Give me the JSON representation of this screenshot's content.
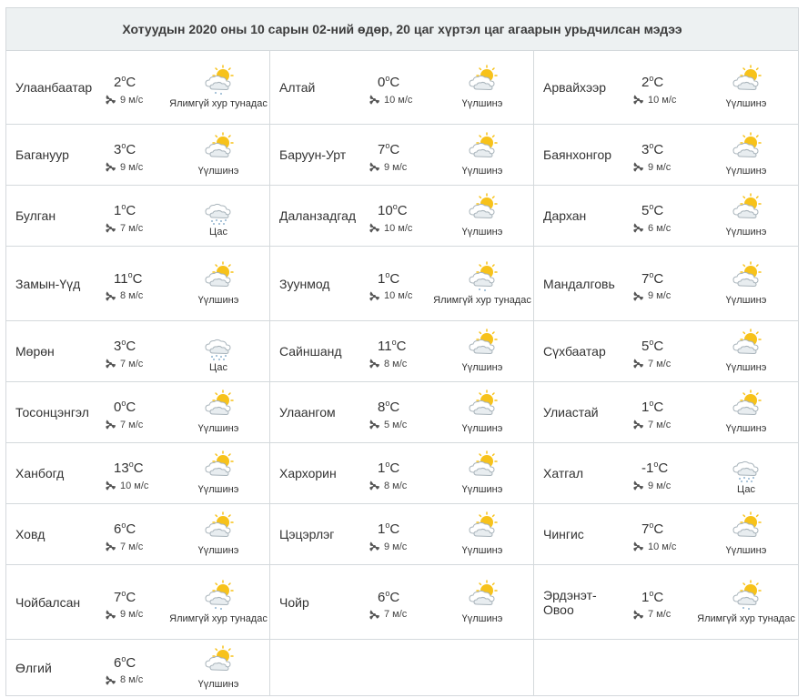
{
  "header": {
    "title": "Хотуудын 2020 оны 10 сарын 02-ний өдөр, 20 цаг хүртэл цаг агаарын урьдчилсан мэдээ"
  },
  "rows": [
    [
      {
        "city": "Улаанбаатар",
        "temp": "2",
        "unit": "C",
        "wind": "9 м/с",
        "icon": "partly-sunny-sleet-icon",
        "desc": "Ялимгүй хур тунадас"
      },
      {
        "city": "Алтай",
        "temp": "0",
        "unit": "C",
        "wind": "10 м/с",
        "icon": "partly-cloudy-icon",
        "desc": "Үүлшинэ"
      },
      {
        "city": "Арвайхээр",
        "temp": "2",
        "unit": "C",
        "wind": "10 м/с",
        "icon": "partly-cloudy-icon",
        "desc": "Үүлшинэ"
      }
    ],
    [
      {
        "city": "Багануур",
        "temp": "3",
        "unit": "C",
        "wind": "9 м/с",
        "icon": "partly-cloudy-icon",
        "desc": "Үүлшинэ"
      },
      {
        "city": "Баруун-Урт",
        "temp": "7",
        "unit": "C",
        "wind": "9 м/с",
        "icon": "partly-cloudy-icon",
        "desc": "Үүлшинэ"
      },
      {
        "city": "Баянхонгор",
        "temp": "3",
        "unit": "C",
        "wind": "9 м/с",
        "icon": "partly-cloudy-icon",
        "desc": "Үүлшинэ"
      }
    ],
    [
      {
        "city": "Булган",
        "temp": "1",
        "unit": "C",
        "wind": "7 м/с",
        "icon": "snow-cloud-icon",
        "desc": "Цас"
      },
      {
        "city": "Даланзадгад",
        "temp": "10",
        "unit": "C",
        "wind": "10 м/с",
        "icon": "partly-cloudy-icon",
        "desc": "Үүлшинэ"
      },
      {
        "city": "Дархан",
        "temp": "5",
        "unit": "C",
        "wind": "6 м/с",
        "icon": "partly-cloudy-icon",
        "desc": "Үүлшинэ"
      }
    ],
    [
      {
        "city": "Замын-Үүд",
        "temp": "11",
        "unit": "C",
        "wind": "8 м/с",
        "icon": "partly-cloudy-icon",
        "desc": "Үүлшинэ"
      },
      {
        "city": "Зуунмод",
        "temp": "1",
        "unit": "C",
        "wind": "10 м/с",
        "icon": "partly-sunny-sleet-icon",
        "desc": "Ялимгүй хур тунадас"
      },
      {
        "city": "Мандалговь",
        "temp": "7",
        "unit": "C",
        "wind": "9 м/с",
        "icon": "partly-cloudy-icon",
        "desc": "Үүлшинэ"
      }
    ],
    [
      {
        "city": "Мөрөн",
        "temp": "3",
        "unit": "C",
        "wind": "7 м/с",
        "icon": "snow-cloud-icon",
        "desc": "Цас"
      },
      {
        "city": "Сайншанд",
        "temp": "11",
        "unit": "C",
        "wind": "8 м/с",
        "icon": "partly-cloudy-icon",
        "desc": "Үүлшинэ"
      },
      {
        "city": "Сүхбаатар",
        "temp": "5",
        "unit": "C",
        "wind": "7 м/с",
        "icon": "partly-cloudy-icon",
        "desc": "Үүлшинэ"
      }
    ],
    [
      {
        "city": "Тосонцэнгэл",
        "temp": "0",
        "unit": "C",
        "wind": "7 м/с",
        "icon": "partly-cloudy-icon",
        "desc": "Үүлшинэ"
      },
      {
        "city": "Улаангом",
        "temp": "8",
        "unit": "C",
        "wind": "5 м/с",
        "icon": "partly-cloudy-icon",
        "desc": "Үүлшинэ"
      },
      {
        "city": "Улиастай",
        "temp": "1",
        "unit": "C",
        "wind": "7 м/с",
        "icon": "partly-cloudy-icon",
        "desc": "Үүлшинэ"
      }
    ],
    [
      {
        "city": "Ханбогд",
        "temp": "13",
        "unit": "C",
        "wind": "10 м/с",
        "icon": "partly-cloudy-icon",
        "desc": "Үүлшинэ"
      },
      {
        "city": "Хархорин",
        "temp": "1",
        "unit": "C",
        "wind": "8 м/с",
        "icon": "partly-cloudy-icon",
        "desc": "Үүлшинэ"
      },
      {
        "city": "Хатгал",
        "temp": "-1",
        "unit": "C",
        "wind": "9 м/с",
        "icon": "snow-cloud-icon",
        "desc": "Цас"
      }
    ],
    [
      {
        "city": "Ховд",
        "temp": "6",
        "unit": "C",
        "wind": "7 м/с",
        "icon": "partly-cloudy-icon",
        "desc": "Үүлшинэ"
      },
      {
        "city": "Цэцэрлэг",
        "temp": "1",
        "unit": "C",
        "wind": "9 м/с",
        "icon": "partly-cloudy-icon",
        "desc": "Үүлшинэ"
      },
      {
        "city": "Чингис",
        "temp": "7",
        "unit": "C",
        "wind": "10 м/с",
        "icon": "partly-cloudy-icon",
        "desc": "Үүлшинэ"
      }
    ],
    [
      {
        "city": "Чойбалсан",
        "temp": "7",
        "unit": "C",
        "wind": "9 м/с",
        "icon": "partly-sunny-sleet-icon",
        "desc": "Ялимгүй хур тунадас"
      },
      {
        "city": "Чойр",
        "temp": "6",
        "unit": "C",
        "wind": "7 м/с",
        "icon": "partly-cloudy-icon",
        "desc": "Үүлшинэ"
      },
      {
        "city": "Эрдэнэт-Овоо",
        "temp": "1",
        "unit": "C",
        "wind": "7 м/с",
        "icon": "partly-sunny-sleet-icon",
        "desc": "Ялимгүй хур тунадас"
      }
    ],
    [
      {
        "city": "Өлгий",
        "temp": "6",
        "unit": "C",
        "wind": "8 м/с",
        "icon": "partly-cloudy-icon",
        "desc": "Үүлшинэ"
      },
      null,
      null
    ]
  ]
}
